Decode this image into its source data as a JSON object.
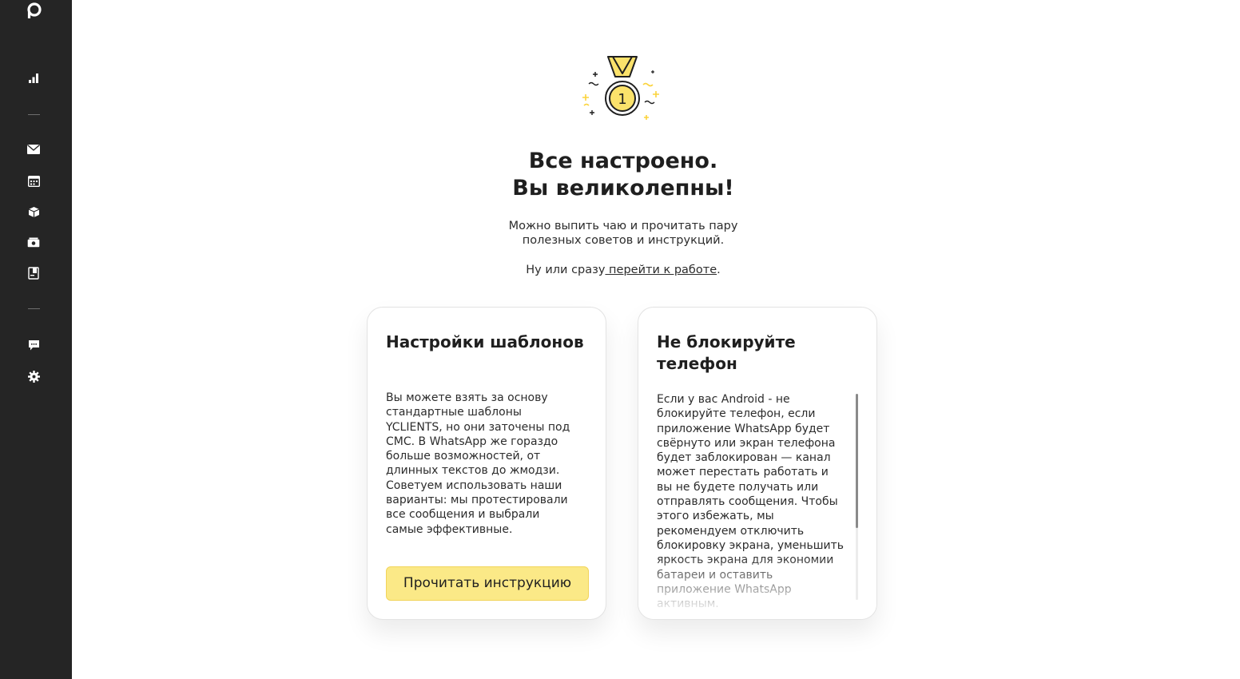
{
  "sidebar": {
    "items": [
      {
        "icon": "bar-chart-icon"
      },
      {
        "icon": "mail-icon"
      },
      {
        "icon": "calendar-icon"
      },
      {
        "icon": "box-icon"
      },
      {
        "icon": "cash-icon"
      },
      {
        "icon": "book-icon"
      },
      {
        "icon": "chat-icon"
      },
      {
        "icon": "gear-icon"
      }
    ]
  },
  "hero": {
    "title_line1": "Все настроено.",
    "title_line2": "Вы великолепны!",
    "subtitle_line1": "Можно выпить чаю и прочитать пару",
    "subtitle_line2": "полезных советов и инструкций.",
    "cta_prefix": "Ну или сразу",
    "cta_link": " перейти к работе",
    "cta_suffix": ".",
    "medal_number": "1"
  },
  "cards": [
    {
      "title": "Настройки шаблонов",
      "text": "Вы можете взять за основу стандартные шаблоны YCLIENTS, но они заточены под СМС. В WhatsApp же гораздо больше возможностей, от длинных текстов до жмодзи. Советуем использовать наши варианты: мы протестировали все сообщения и выбрали самые эффективные.",
      "button_label": "Прочитать инструкцию"
    },
    {
      "title": "Не блокируйте телефон",
      "text": "Если у вас Android - не блокируйте телефон, если приложение WhatsApp будет свёрнуто или экран телефона будет заблокирован — канал может перестать работать и вы не будете получать или отправлять сообщения. Чтобы этого избежать, мы рекомендуем отключить блокировку экрана, уменьшить яркость экрана для экономии батареи и оставить приложение WhatsApp активным."
    }
  ],
  "colors": {
    "sidebar_bg": "#252525",
    "button_bg": "#fbe987",
    "medal_gold": "#fbe26b"
  }
}
